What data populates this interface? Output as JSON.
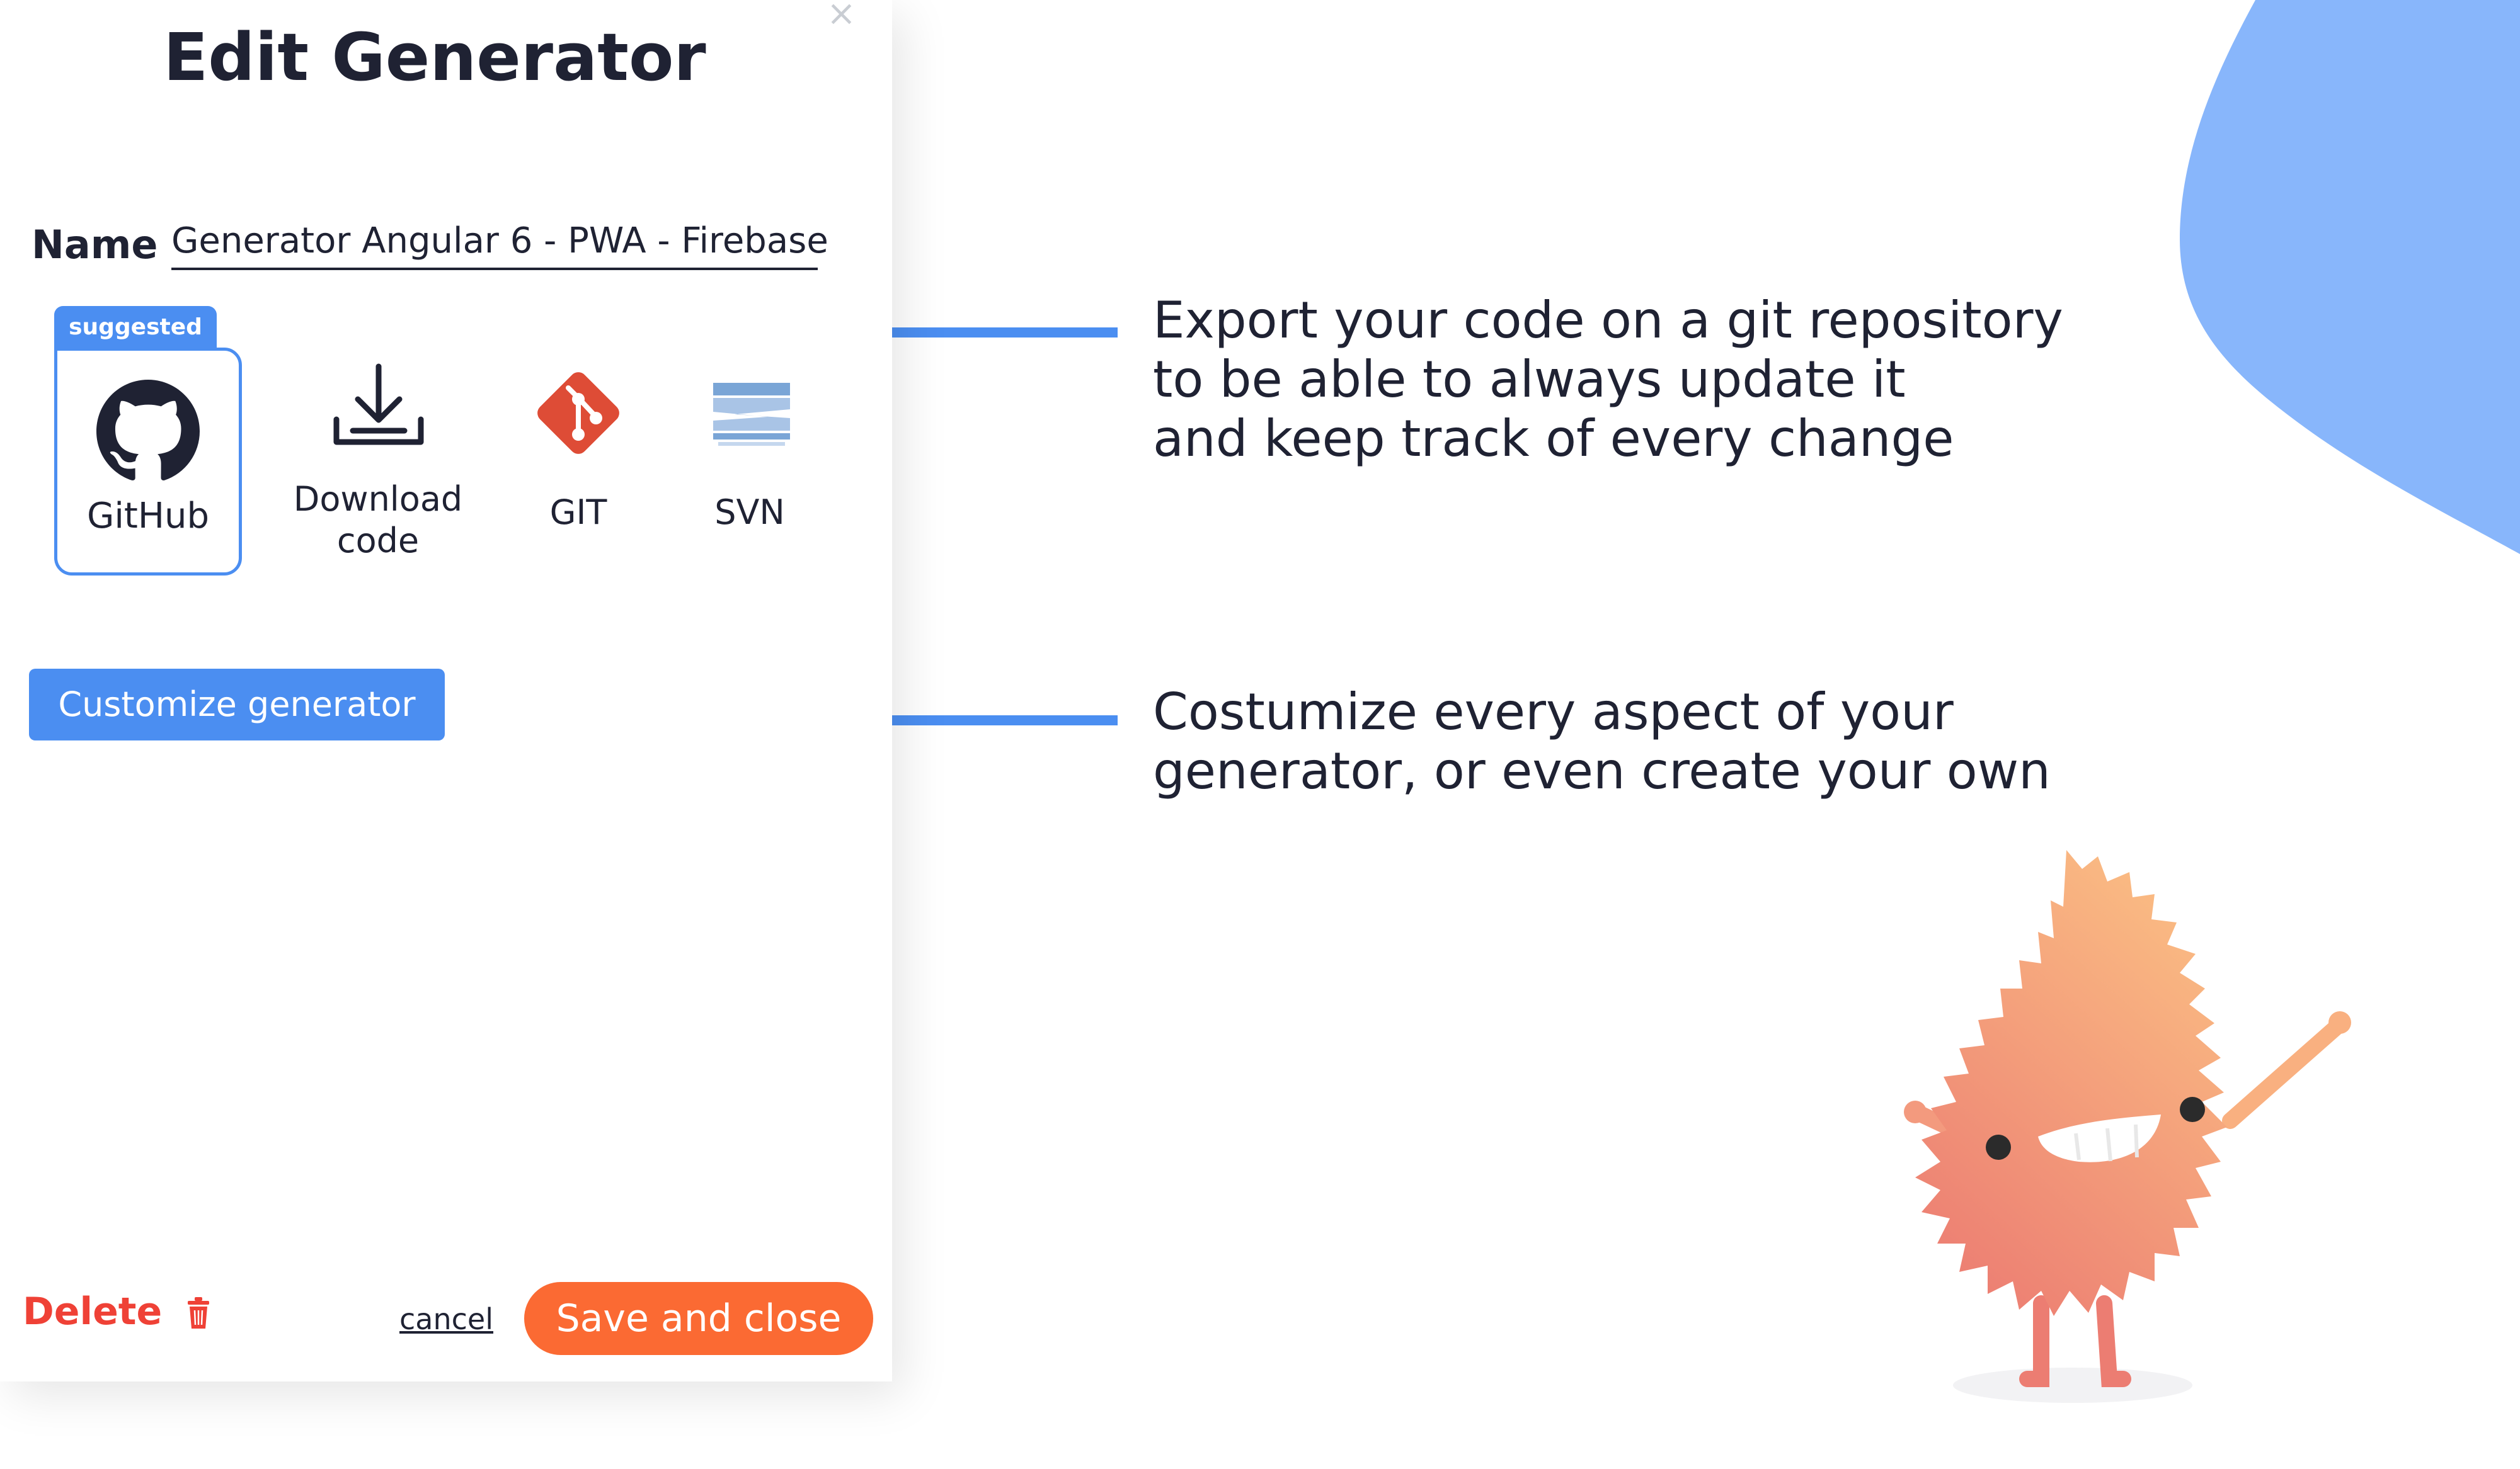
{
  "modal": {
    "close_glyph": "×",
    "title": "Edit Generator",
    "name_label": "Name",
    "name_value": "Generator Angular 6 - PWA - Firebase",
    "suggested_tag": "suggested",
    "export_options": [
      {
        "label": "GitHub",
        "icon": "github-icon",
        "suggested": true
      },
      {
        "label_line1": "Download",
        "label_line2": "code",
        "icon": "download-icon"
      },
      {
        "label": "GIT",
        "icon": "git-icon"
      },
      {
        "label": "SVN",
        "icon": "svn-icon"
      }
    ],
    "customize_label": "Customize generator",
    "footer": {
      "delete_label": "Delete",
      "cancel_label": "cancel",
      "save_label": "Save and close"
    }
  },
  "callouts": {
    "export": {
      "line1": "Export your code on a git repository",
      "line2": "to be able to always update it",
      "line3": "and keep track of every change"
    },
    "customize": {
      "line1": "Costumize every aspect of your",
      "line2": "generator, or even create your own"
    }
  },
  "colors": {
    "accent_blue": "#4b8ef1",
    "save_orange": "#fb6a33",
    "delete_red": "#ef4136",
    "git_red": "#de4c36",
    "blob_blue": "#88b6fb",
    "monster_orange": "#f79a72"
  }
}
